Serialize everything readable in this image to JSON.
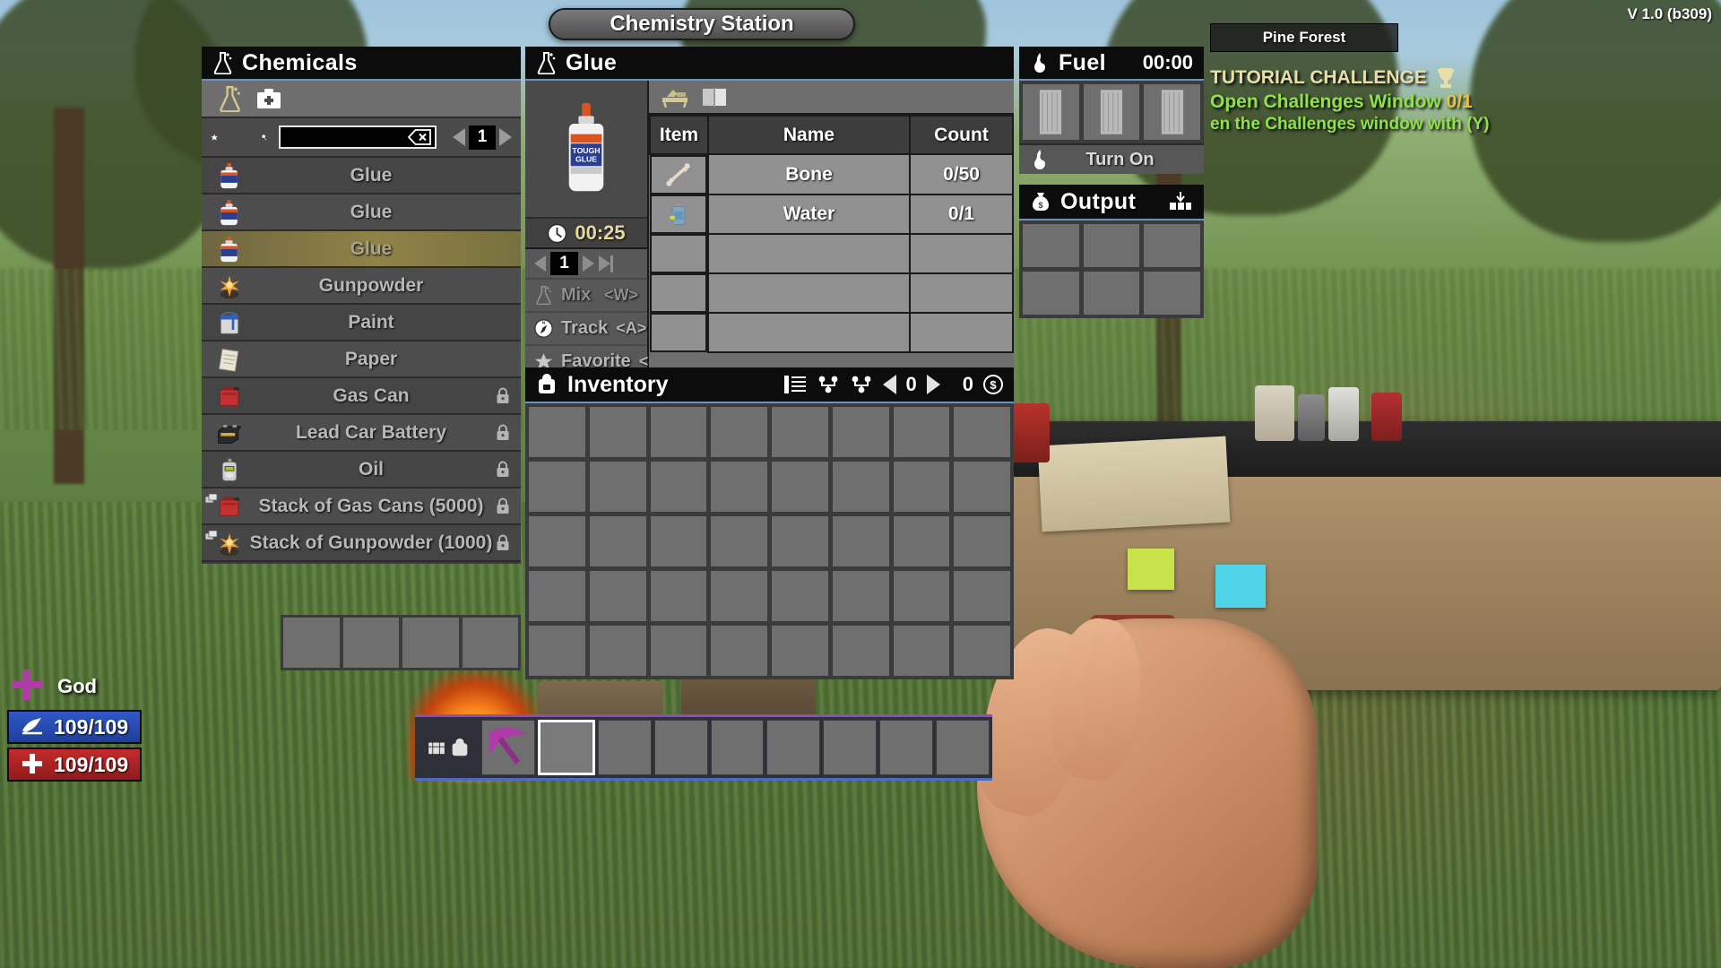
{
  "hud": {
    "version": "V 1.0 (b309)",
    "biome": "Pine Forest",
    "challenge_title": "TUTORIAL CHALLENGE",
    "challenge_line": "Open Challenges Window",
    "challenge_count": "0/1",
    "challenge_sub": "en the Challenges window with (Y)",
    "god_label": "God",
    "stamina": "109/109",
    "health": "109/109"
  },
  "station": {
    "title": "Chemistry Station"
  },
  "chemicals": {
    "title": "Chemicals",
    "title_icon": "flask-icon",
    "toolbar_icons": [
      "flask-icon",
      "medkit-icon"
    ],
    "search": {
      "value": "",
      "placeholder": "",
      "icon": "magnifier-icon",
      "clear_icon": "backspace-icon"
    },
    "favorite_icon": "star-icon",
    "page": "1",
    "items": [
      {
        "name": "Glue",
        "icon": "glue-bottle-icon",
        "locked": false,
        "selected": false,
        "stack": false
      },
      {
        "name": "Glue",
        "icon": "glue-bottle-icon",
        "locked": false,
        "selected": false,
        "stack": false
      },
      {
        "name": "Glue",
        "icon": "glue-bottle-icon",
        "locked": false,
        "selected": true,
        "stack": false
      },
      {
        "name": "Gunpowder",
        "icon": "gunpowder-icon",
        "locked": false,
        "selected": false,
        "stack": false
      },
      {
        "name": "Paint",
        "icon": "paint-can-icon",
        "locked": false,
        "selected": false,
        "stack": false
      },
      {
        "name": "Paper",
        "icon": "paper-icon",
        "locked": false,
        "selected": false,
        "stack": false
      },
      {
        "name": "Gas Can",
        "icon": "gas-can-icon",
        "locked": true,
        "selected": false,
        "stack": false
      },
      {
        "name": "Lead Car Battery",
        "icon": "car-battery-icon",
        "locked": true,
        "selected": false,
        "stack": false
      },
      {
        "name": "Oil",
        "icon": "oil-bottle-icon",
        "locked": true,
        "selected": false,
        "stack": false
      },
      {
        "name": "Stack of Gas Cans (5000)",
        "icon": "gas-can-icon",
        "locked": true,
        "selected": false,
        "stack": true
      },
      {
        "name": "Stack of Gunpowder (1000)",
        "icon": "gunpowder-icon",
        "locked": true,
        "selected": false,
        "stack": true
      }
    ],
    "bottom_slots": 4
  },
  "recipe": {
    "title": "Glue",
    "title_icon": "flask-icon",
    "preview_icon": "glue-bottle-icon",
    "craft_time": "00:25",
    "clock_icon": "clock-icon",
    "quantity": "1",
    "actions": [
      {
        "label": "Mix",
        "key": "<W>",
        "icon": "flask-icon",
        "enabled": false
      },
      {
        "label": "Track",
        "key": "<A>",
        "icon": "compass-icon",
        "enabled": true
      },
      {
        "label": "Favorite",
        "key": "<S>",
        "icon": "star-icon",
        "enabled": true
      }
    ],
    "tabs": [
      "workbench-icon",
      "book-icon"
    ],
    "table": {
      "headers": [
        "Item",
        "Name",
        "Count"
      ],
      "rows": [
        {
          "icon": "bone-icon",
          "name": "Bone",
          "count": "0/50"
        },
        {
          "icon": "water-icon",
          "name": "Water",
          "count": "0/1"
        },
        {
          "icon": "",
          "name": "",
          "count": ""
        },
        {
          "icon": "",
          "name": "",
          "count": ""
        },
        {
          "icon": "",
          "name": "",
          "count": ""
        }
      ]
    }
  },
  "fuel": {
    "title": "Fuel",
    "icon": "flame-icon",
    "timer": "00:00",
    "slots": [
      "wood-plank-icon",
      "wood-plank-icon",
      "wood-plank-icon"
    ],
    "turn_on_label": "Turn On",
    "turn_on_icon": "flame-icon"
  },
  "output": {
    "title": "Output",
    "icon": "money-bag-icon",
    "action_icon": "take-all-icon",
    "slots_rows": 2,
    "slots_cols": 3
  },
  "inventory": {
    "title": "Inventory",
    "icon": "backpack-icon",
    "header_icons": [
      "list-sort-icon",
      "sort-asc-icon",
      "sort-desc-icon"
    ],
    "page": "0",
    "money": "0",
    "money_icon": "dollar-icon",
    "rows": 5,
    "cols": 8
  },
  "toolbelt": {
    "slots": 9,
    "active_index": 1,
    "first_icons": [
      "crate-icon",
      "backpack-icon"
    ],
    "held_icon": "pickaxe-icon"
  }
}
